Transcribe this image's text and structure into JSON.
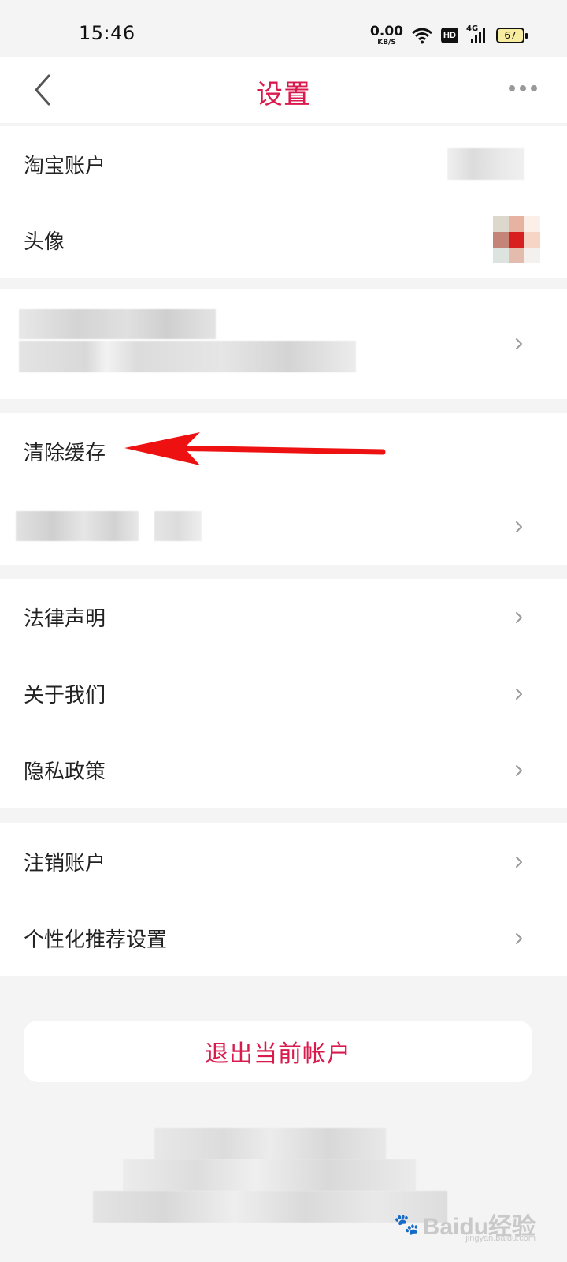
{
  "status_bar": {
    "time": "15:46",
    "net_speed_value": "0.00",
    "net_speed_unit": "KB/S",
    "hd_label": "HD",
    "signal_label": "4G",
    "battery": "67"
  },
  "header": {
    "title": "设置",
    "back_icon": "chevron-left-icon",
    "more_icon": "more-dots-icon"
  },
  "sections": {
    "account": {
      "taobao_account_label": "淘宝账户",
      "avatar_label": "头像"
    },
    "storage": {
      "clear_cache_label": "清除缓存"
    },
    "about": {
      "legal_label": "法律声明",
      "about_us_label": "关于我们",
      "privacy_label": "隐私政策"
    },
    "account_actions": {
      "deregister_label": "注销账户",
      "personalized_label": "个性化推荐设置"
    }
  },
  "logout_button": "退出当前帐户",
  "watermark": {
    "text": "Baidu经验",
    "sub": "jingyan.baidu.com"
  },
  "colors": {
    "accent": "#d91a4d",
    "background": "#f4f4f4",
    "annotation_arrow": "#ee1111"
  }
}
